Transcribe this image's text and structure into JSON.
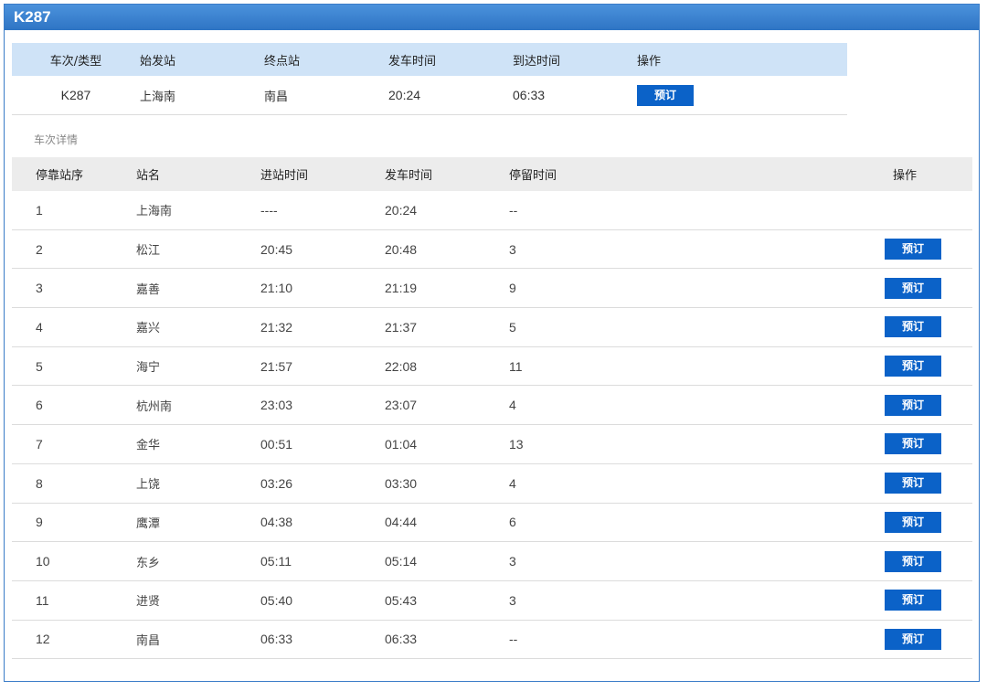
{
  "train": {
    "title": "K287"
  },
  "summary": {
    "headers": [
      "车次/类型",
      "始发站",
      "终点站",
      "发车时间",
      "到达时间",
      "操作"
    ],
    "row": {
      "train_no": "K287",
      "origin": "上海南",
      "destination": "南昌",
      "depart": "20:24",
      "arrive": "06:33",
      "book_label": "预订"
    }
  },
  "details": {
    "section_label": "车次详情",
    "headers": [
      "停靠站序",
      "站名",
      "进站时间",
      "发车时间",
      "停留时间",
      "操作"
    ],
    "book_label": "预订",
    "stops": [
      {
        "seq": "1",
        "station": "上海南",
        "arrive": "----",
        "depart": "20:24",
        "stay": "--",
        "bookable": false
      },
      {
        "seq": "2",
        "station": "松江",
        "arrive": "20:45",
        "depart": "20:48",
        "stay": "3",
        "bookable": true
      },
      {
        "seq": "3",
        "station": "嘉善",
        "arrive": "21:10",
        "depart": "21:19",
        "stay": "9",
        "bookable": true
      },
      {
        "seq": "4",
        "station": "嘉兴",
        "arrive": "21:32",
        "depart": "21:37",
        "stay": "5",
        "bookable": true
      },
      {
        "seq": "5",
        "station": "海宁",
        "arrive": "21:57",
        "depart": "22:08",
        "stay": "11",
        "bookable": true
      },
      {
        "seq": "6",
        "station": "杭州南",
        "arrive": "23:03",
        "depart": "23:07",
        "stay": "4",
        "bookable": true
      },
      {
        "seq": "7",
        "station": "金华",
        "arrive": "00:51",
        "depart": "01:04",
        "stay": "13",
        "bookable": true
      },
      {
        "seq": "8",
        "station": "上饶",
        "arrive": "03:26",
        "depart": "03:30",
        "stay": "4",
        "bookable": true
      },
      {
        "seq": "9",
        "station": "鹰潭",
        "arrive": "04:38",
        "depart": "04:44",
        "stay": "6",
        "bookable": true
      },
      {
        "seq": "10",
        "station": "东乡",
        "arrive": "05:11",
        "depart": "05:14",
        "stay": "3",
        "bookable": true
      },
      {
        "seq": "11",
        "station": "进贤",
        "arrive": "05:40",
        "depart": "05:43",
        "stay": "3",
        "bookable": true
      },
      {
        "seq": "12",
        "station": "南昌",
        "arrive": "06:33",
        "depart": "06:33",
        "stay": "--",
        "bookable": true
      }
    ]
  },
  "colors": {
    "title_bar": "#3a82d2",
    "summary_header_bg": "#cfe3f7",
    "detail_header_bg": "#ececec",
    "button_bg": "#0b62c8"
  }
}
